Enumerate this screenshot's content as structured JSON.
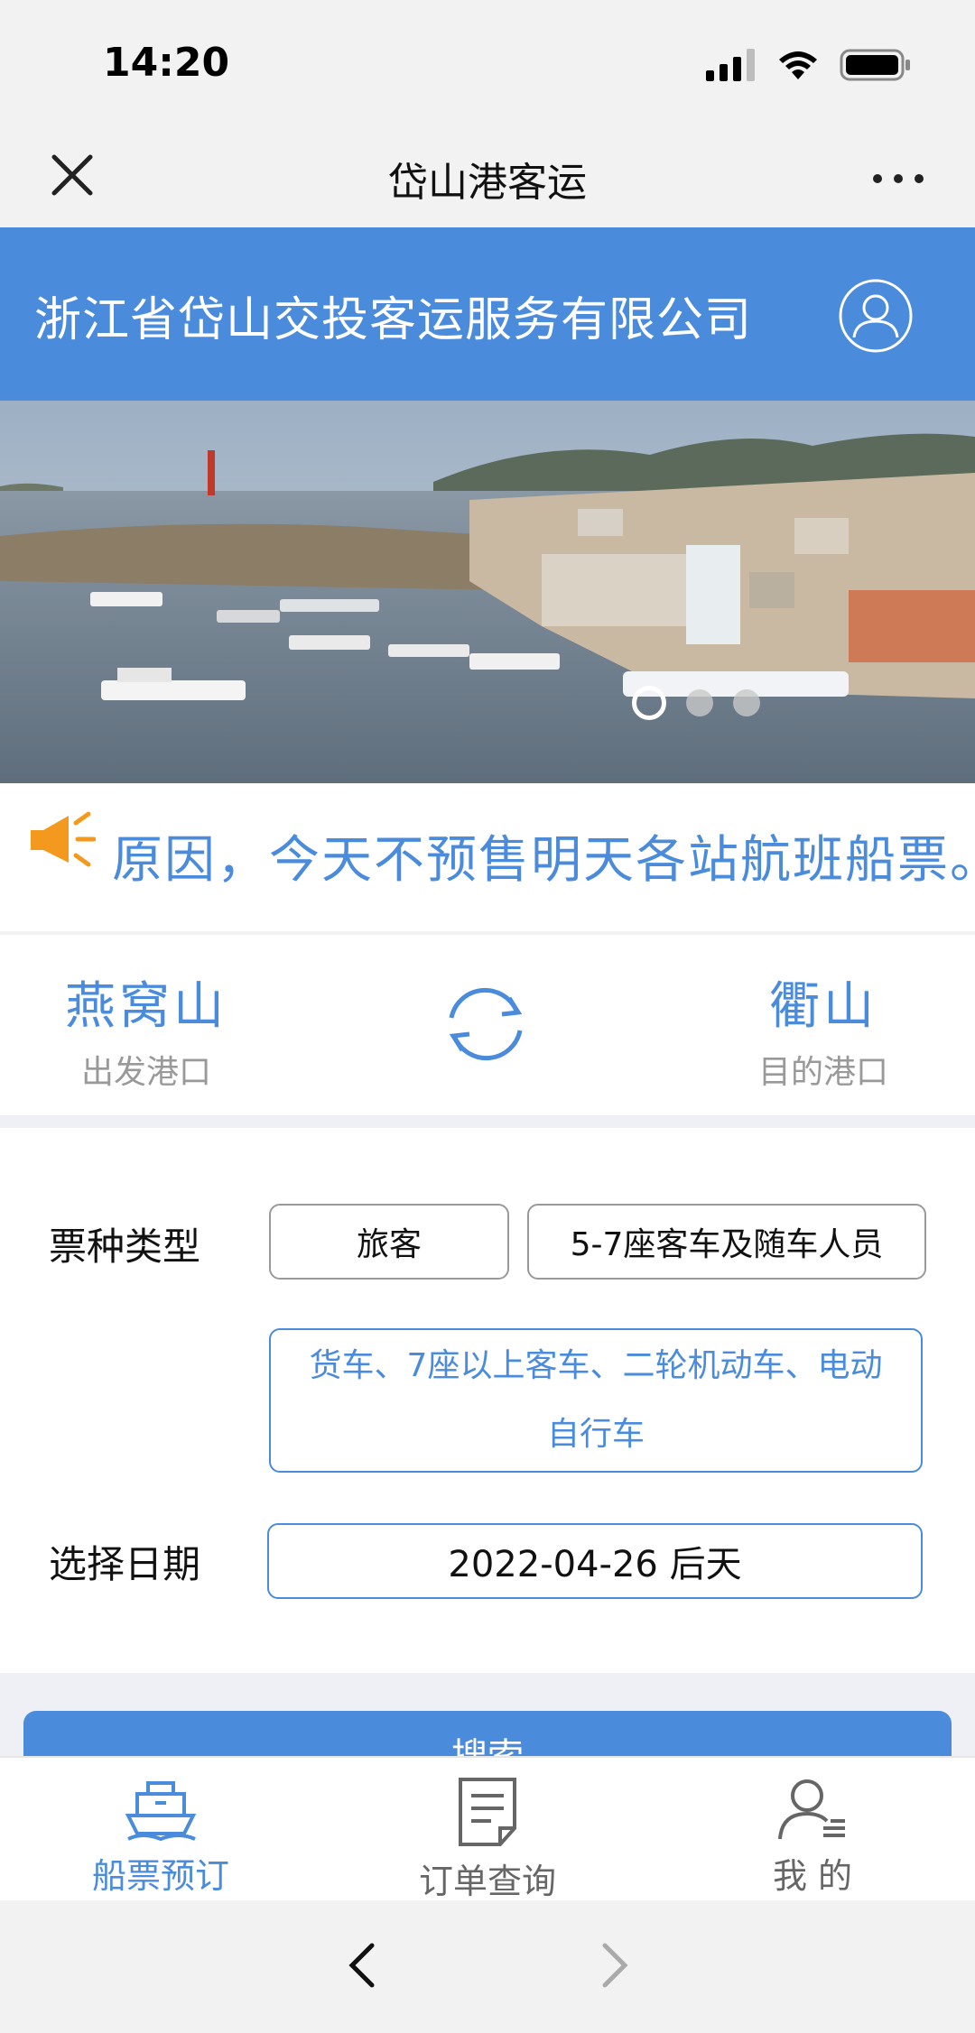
{
  "status_bar": {
    "time": "14:20"
  },
  "nav": {
    "title": "岱山港客运"
  },
  "header": {
    "company_name": "浙江省岱山交投客运服务有限公司"
  },
  "banner": {
    "slides": 3,
    "active_index": 0
  },
  "notice": {
    "text": "原因，今天不预售明天各站航班船票。"
  },
  "route": {
    "from_port": "燕窝山",
    "from_label": "出发港口",
    "to_port": "衢山",
    "to_label": "目的港口"
  },
  "form": {
    "ticket_type_label": "票种类型",
    "ticket_options": [
      "旅客",
      "5-7座客车及随车人员",
      "货车、7座以上客车、二轮机动车、电动自行车"
    ],
    "selected_ticket_index": 2,
    "date_label": "选择日期",
    "date_value": "2022-04-26 后天"
  },
  "search_button": {
    "label": "搜索"
  },
  "tabs": [
    {
      "label": "船票预订",
      "icon": "ship-icon",
      "active": true
    },
    {
      "label": "订单查询",
      "icon": "document-icon",
      "active": false
    },
    {
      "label": "我 的",
      "icon": "user-icon",
      "active": false
    }
  ],
  "colors": {
    "accent": "#4a8bdc",
    "inactive_tab": "#666666",
    "notice_icon": "#f39a1e"
  }
}
